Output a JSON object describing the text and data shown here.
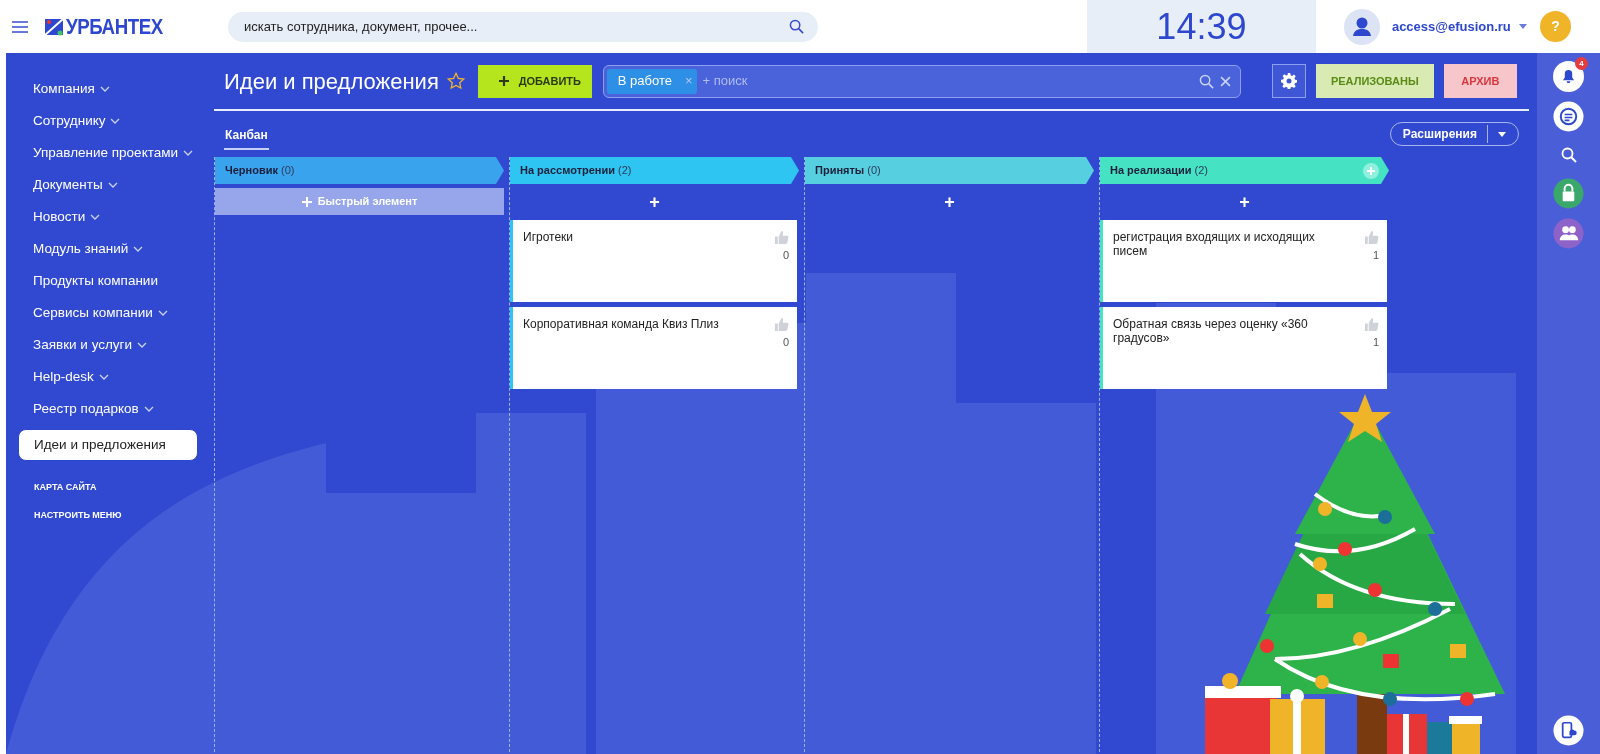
{
  "header": {
    "logo_text": "УРБАНТЕХ",
    "search_placeholder": "искать сотрудника, документ, прочее...",
    "clock": "14:39",
    "user_email": "access@efusion.ru",
    "help": "?"
  },
  "sidebar": {
    "items": [
      {
        "label": "Компания",
        "has_submenu": true,
        "selected": false
      },
      {
        "label": "Сотруднику",
        "has_submenu": true,
        "selected": false
      },
      {
        "label": "Управление проектами",
        "has_submenu": true,
        "selected": false
      },
      {
        "label": "Документы",
        "has_submenu": true,
        "selected": false
      },
      {
        "label": "Новости",
        "has_submenu": true,
        "selected": false
      },
      {
        "label": "Модуль знаний",
        "has_submenu": true,
        "selected": false
      },
      {
        "label": "Продукты компании",
        "has_submenu": false,
        "selected": false
      },
      {
        "label": "Сервисы компании",
        "has_submenu": true,
        "selected": false
      },
      {
        "label": "Заявки и услуги",
        "has_submenu": true,
        "selected": false
      },
      {
        "label": "Help-desk",
        "has_submenu": true,
        "selected": false
      },
      {
        "label": "Реестр подарков",
        "has_submenu": true,
        "selected": false
      },
      {
        "label": "Идеи и предложения",
        "has_submenu": false,
        "selected": true
      }
    ],
    "footer_links": [
      "КАРТА САЙТА",
      "НАСТРОИТЬ МЕНЮ"
    ]
  },
  "page": {
    "title": "Идеи и предложения",
    "add_button": "ДОБАВИТЬ",
    "filter": {
      "tags": [
        {
          "label": "В работе",
          "remove": "×"
        }
      ],
      "placeholder": "+ поиск"
    },
    "buttons": [
      {
        "label": "РЕАЛИЗОВАНЫ",
        "kind": "done"
      },
      {
        "label": "АРХИВ",
        "kind": "archive"
      }
    ],
    "tabs": [
      {
        "label": "Канбан",
        "selected": true
      }
    ],
    "extensions_button": "Расширения"
  },
  "kanban": {
    "columns": [
      {
        "name": "Черновик",
        "count": "(0)",
        "color": "#3aa3ee",
        "add": {
          "kind": "quick",
          "label": "Быстрый элемент"
        },
        "header_add": false
      },
      {
        "name": "На рассмотрении",
        "count": "(2)",
        "color": "#2ec5f2",
        "add": {
          "kind": "plus",
          "label": "+"
        },
        "header_add": false,
        "cards": [
          {
            "title": "Игротеки",
            "likes": "0"
          },
          {
            "title": "Корпоративная команда Квиз Плиз",
            "likes": "0"
          }
        ]
      },
      {
        "name": "Приняты",
        "count": "(0)",
        "color": "#56cfe0",
        "add": {
          "kind": "plus",
          "label": "+"
        },
        "header_add": false
      },
      {
        "name": "На реализации",
        "count": "(2)",
        "color": "#45e2c4",
        "add": {
          "kind": "plus",
          "label": "+"
        },
        "header_add": true,
        "cards": [
          {
            "title": "регистрация входящих и исходящих писем",
            "likes": "1"
          },
          {
            "title": "Обратная связь через оценку «360 градусов»",
            "likes": "1"
          }
        ]
      }
    ]
  },
  "right_rail": {
    "notifications_badge": "4"
  }
}
